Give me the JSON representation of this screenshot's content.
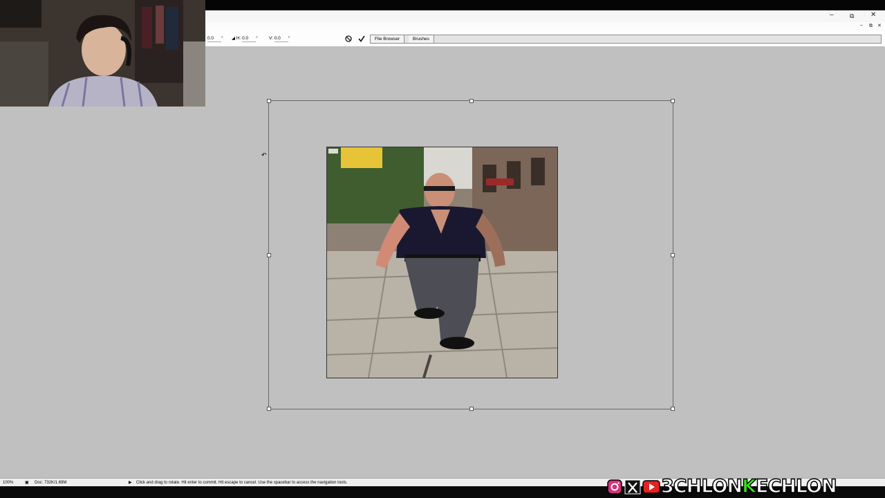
{
  "colors": {
    "canvas_bg": "#c0c0c0",
    "chrome": "#fbfbfb",
    "brand_accent": "#35e51c"
  },
  "optionsbar": {
    "angle_value": "0.0",
    "angle_unit": "°",
    "h_label": "H:",
    "h_value": "0.0",
    "h_unit": "°",
    "v_label": "V:",
    "v_value": "0.0",
    "v_unit": "°",
    "cancel_icon": "cancel-transform-icon",
    "commit_icon": "commit-transform-icon"
  },
  "palette_well": {
    "tabs": [
      "File Browser",
      "Brushes"
    ]
  },
  "statusbar": {
    "zoom": "100%",
    "doc_info": "Doc: 732K/1.69M",
    "hint": "Click and drag to rotate. Hit enter to commit. Hit escape to cancel. Use the spacebar to access the navigation tools."
  },
  "branding": {
    "icons": [
      "instagram-icon",
      "x-icon",
      "youtube-icon"
    ],
    "text_before": "3CHLON",
    "highlight": "K",
    "text_after": "ECHLON"
  }
}
